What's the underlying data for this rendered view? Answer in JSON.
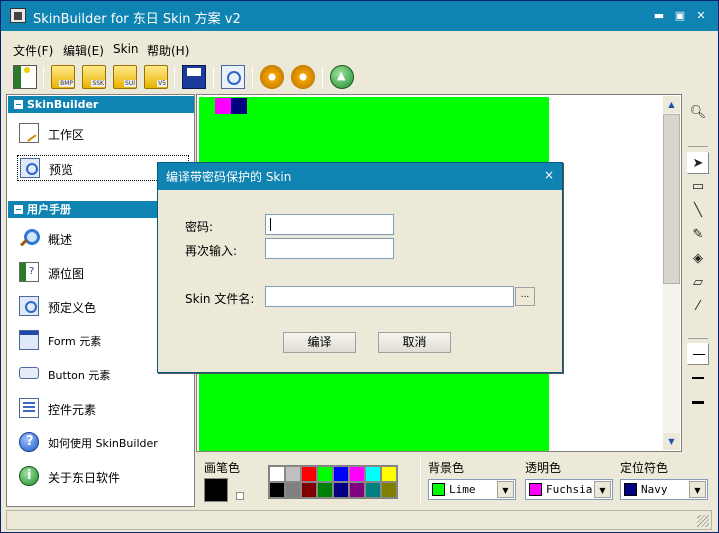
{
  "window": {
    "title": "SkinBuilder for 东日 Skin 方案 v2",
    "minimize_glyph": "▬",
    "maximize_glyph": "▣",
    "close_glyph": "✕",
    "accent": "#0f84b2"
  },
  "menu": [
    "文件(F)",
    "编辑(E)",
    "Skin",
    "帮助(H)"
  ],
  "toolbar": {
    "icons": [
      "new-icon",
      "open-bmp-icon",
      "open-ssk-icon",
      "open-sui-icon",
      "open-vs-icon",
      "save-icon",
      "preview-icon",
      "compile-icon",
      "compile-protected-icon",
      "publish-icon"
    ],
    "folder_tags": [
      "BMP",
      "SSK",
      "SUI",
      "V5"
    ]
  },
  "sidebar": {
    "sections": [
      {
        "header": "SkinBuilder",
        "items": [
          {
            "label": "工作区",
            "icon": "workspace-icon"
          },
          {
            "label": "预览",
            "icon": "preview-icon"
          }
        ]
      },
      {
        "header": "用户手册",
        "items": [
          {
            "label": "概述",
            "icon": "overview-icon"
          },
          {
            "label": "源位图",
            "icon": "source-bitmap-icon"
          },
          {
            "label": "预定义色",
            "icon": "predefined-color-icon"
          },
          {
            "label": "Form 元素",
            "icon": "form-element-icon"
          },
          {
            "label": "Button 元素",
            "icon": "button-element-icon"
          },
          {
            "label": "控件元素",
            "icon": "control-element-icon"
          },
          {
            "label": "如何使用 SkinBuilder",
            "icon": "help-icon"
          },
          {
            "label": "关于东日软件",
            "icon": "about-icon"
          }
        ]
      }
    ]
  },
  "canvas": {
    "background": "#00ff00",
    "pixels": [
      "#ff00ff",
      "#000080"
    ]
  },
  "tools": [
    "zoom-icon",
    "pointer-icon",
    "rectangle-icon",
    "line-icon",
    "pencil-icon",
    "fill-icon",
    "eraser-icon",
    "eyedropper-icon",
    "line-thin-icon",
    "line-medium-icon",
    "line-thick-icon"
  ],
  "palette": {
    "pen_label": "画笔色",
    "pen_color": "#000000",
    "colors_top": [
      "#ffffff",
      "#c0c0c0",
      "#ff0000",
      "#00ff00",
      "#0000ff",
      "#ff00ff",
      "#00ffff",
      "#ffff00"
    ],
    "colors_bottom": [
      "#000000",
      "#808080",
      "#800000",
      "#008000",
      "#000080",
      "#800080",
      "#008080",
      "#808000"
    ],
    "background": {
      "label": "背景色",
      "value": "Lime",
      "color": "#00ff00"
    },
    "transparent": {
      "label": "透明色",
      "value": "Fuchsia",
      "color": "#ff00ff"
    },
    "locator": {
      "label": "定位符色",
      "value": "Navy",
      "color": "#000080"
    }
  },
  "dialog": {
    "title": "编译带密码保护的 Skin",
    "close_glyph": "×",
    "password_label": "密码:",
    "password_value": "",
    "confirm_label": "再次输入:",
    "confirm_value": "",
    "filename_label": "Skin 文件名:",
    "filename_value": "",
    "browse_label": "...",
    "compile_label": "编译",
    "cancel_label": "取消"
  }
}
